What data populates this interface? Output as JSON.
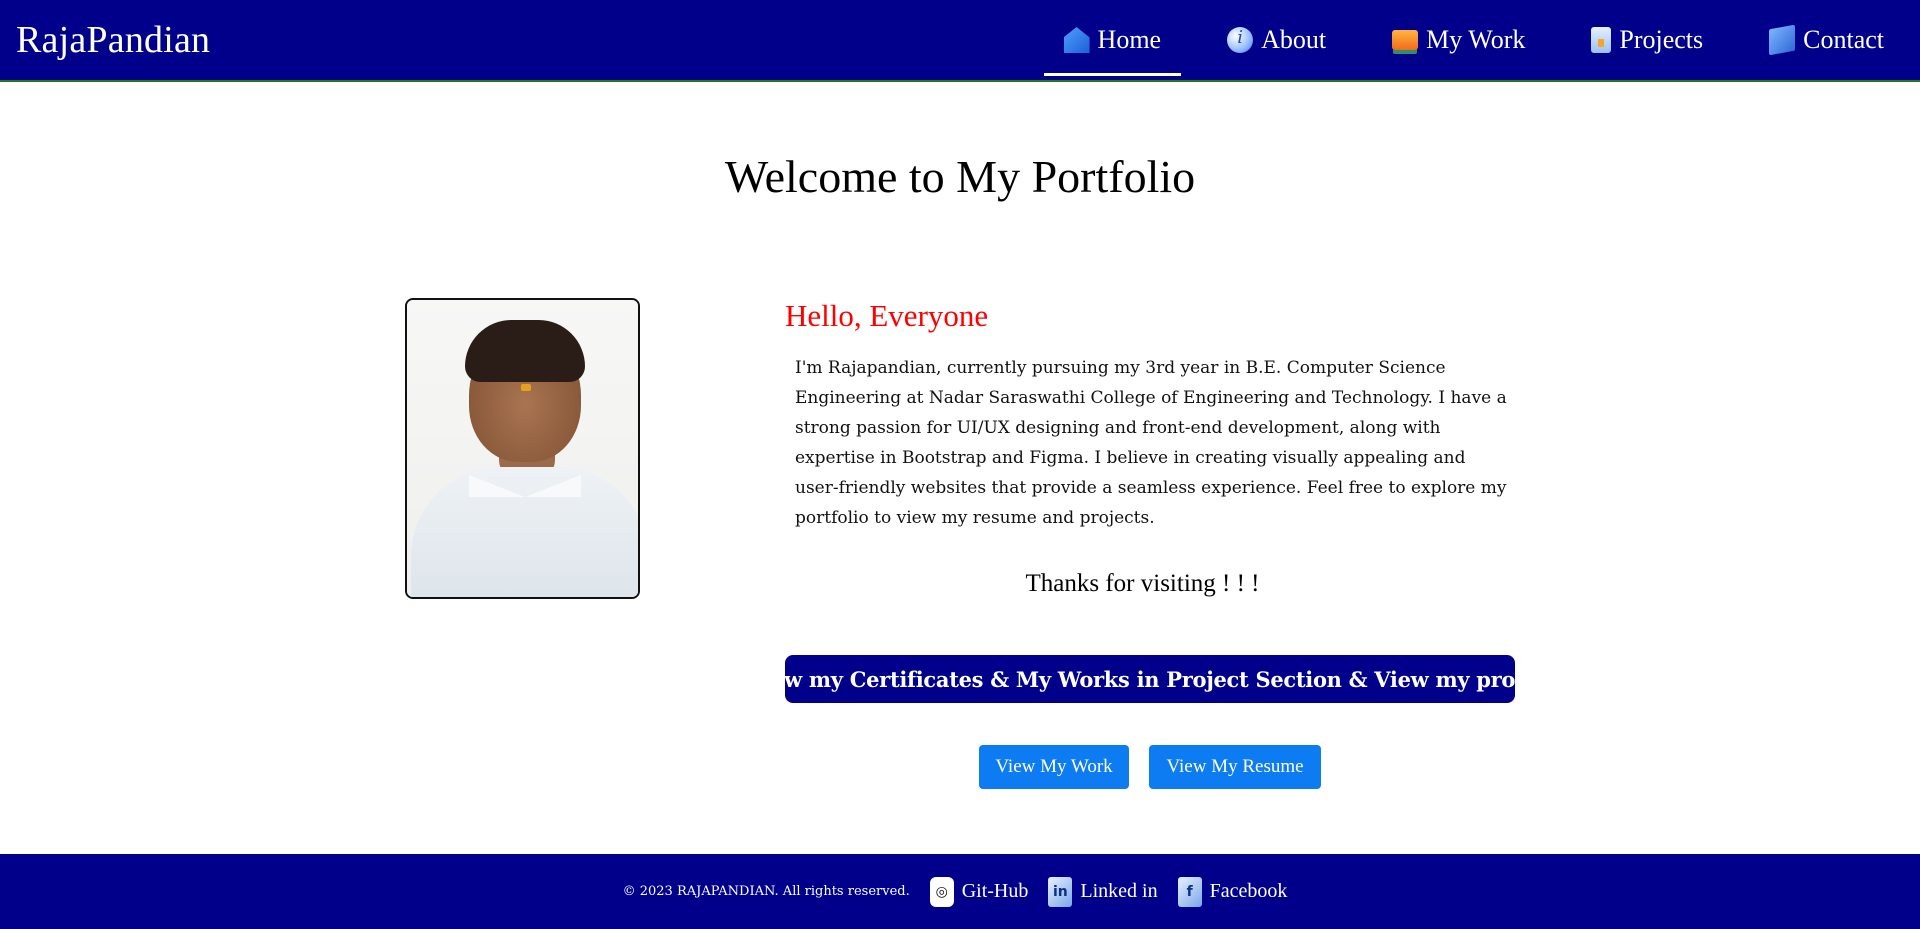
{
  "header": {
    "brand": "RajaPandian",
    "nav": [
      {
        "label": "Home",
        "icon": "home-icon",
        "active": true
      },
      {
        "label": "About",
        "icon": "info-icon",
        "active": false
      },
      {
        "label": "My Work",
        "icon": "monitor-icon",
        "active": false
      },
      {
        "label": "Projects",
        "icon": "document-icon",
        "active": false
      },
      {
        "label": "Contact",
        "icon": "contact-icon",
        "active": false
      }
    ]
  },
  "main": {
    "title": "Welcome to My Portfolio",
    "greeting": "Hello, Everyone",
    "about": "I'm Rajapandian, currently pursuing my 3rd year in B.E. Computer Science Engineering at Nadar Saraswathi College of Engineering and Technology. I have a strong passion for UI/UX designing and front-end development, along with expertise in Bootstrap and Figma. I believe in creating visually appealing and user-friendly websites that provide a seamless experience. Feel free to explore my portfolio to view my resume and projects.",
    "thanks": "Thanks for visiting ! ! !",
    "banner": "View my Certificates & My Works in Project Section & View my profile",
    "buttons": {
      "work": "View My Work",
      "resume": "View My Resume"
    }
  },
  "footer": {
    "copyright": "© 2023 RAJAPANDIAN. All rights reserved.",
    "links": [
      {
        "label": "Git-Hub",
        "icon": "github-icon"
      },
      {
        "label": "Linked in",
        "icon": "linkedin-icon"
      },
      {
        "label": "Facebook",
        "icon": "facebook-icon"
      }
    ]
  },
  "colors": {
    "primary": "#00008b",
    "greeting": "#ff0000",
    "button": "#0d7cf2"
  }
}
